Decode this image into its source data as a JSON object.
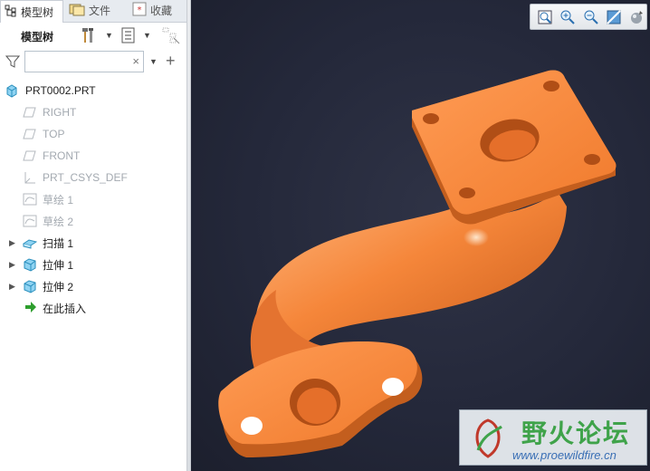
{
  "tabs": [
    {
      "label": "模型树"
    },
    {
      "label": "文件"
    },
    {
      "label": "收藏"
    }
  ],
  "toolbar": {
    "title": "模型树"
  },
  "filter": {
    "search_value": ""
  },
  "tree": {
    "items": [
      {
        "label": "PRT0002.PRT",
        "icon": "part-icon",
        "dim": false,
        "expandable": false
      },
      {
        "label": "RIGHT",
        "icon": "datum-plane-icon",
        "dim": true,
        "expandable": false
      },
      {
        "label": "TOP",
        "icon": "datum-plane-icon",
        "dim": true,
        "expandable": false
      },
      {
        "label": "FRONT",
        "icon": "datum-plane-icon",
        "dim": true,
        "expandable": false
      },
      {
        "label": "PRT_CSYS_DEF",
        "icon": "coordinate-system-icon",
        "dim": true,
        "expandable": false
      },
      {
        "label": "草绘 1",
        "icon": "sketch-icon",
        "dim": true,
        "expandable": false
      },
      {
        "label": "草绘 2",
        "icon": "sketch-icon",
        "dim": true,
        "expandable": false
      },
      {
        "label": "扫描 1",
        "icon": "sweep-icon",
        "dim": false,
        "expandable": true
      },
      {
        "label": "拉伸 1",
        "icon": "extrude-icon",
        "dim": false,
        "expandable": true
      },
      {
        "label": "拉伸 2",
        "icon": "extrude-icon",
        "dim": false,
        "expandable": true
      },
      {
        "label": "在此插入",
        "icon": "insert-arrow-icon",
        "dim": false,
        "expandable": false
      }
    ]
  },
  "watermark": {
    "title": "野火论坛",
    "url": "www.proewildfire.cn"
  },
  "colors": {
    "model": "#f5863a",
    "background": "#252a3b",
    "accent": "#3fa34a"
  }
}
